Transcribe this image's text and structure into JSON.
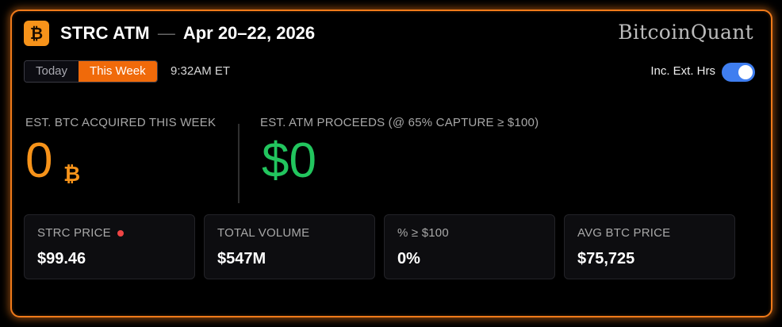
{
  "header": {
    "logo_glyph": "₿",
    "title": "STRC ATM",
    "separator": "—",
    "date_range": "Apr 20–22, 2026",
    "brand": "BitcoinQuant"
  },
  "controls": {
    "tabs": [
      {
        "label": "Today",
        "active": false
      },
      {
        "label": "This Week",
        "active": true
      }
    ],
    "time": "9:32AM ET",
    "ext_hours_label": "Inc. Ext. Hrs",
    "ext_hours_enabled": true
  },
  "summary": {
    "btc_label": "EST. BTC ACQUIRED THIS WEEK",
    "btc_value": "0",
    "btc_unit": "₿",
    "proceeds_label": "EST. ATM PROCEEDS (@ 65% CAPTURE ≥ $100)",
    "proceeds_value": "$0"
  },
  "stats": [
    {
      "label": "STRC PRICE",
      "value": "$99.46",
      "live": true
    },
    {
      "label": "TOTAL VOLUME",
      "value": "$547M",
      "live": false
    },
    {
      "label": "% ≥ $100",
      "value": "0%",
      "live": false
    },
    {
      "label": "AVG BTC PRICE",
      "value": "$75,725",
      "live": false
    }
  ],
  "colors": {
    "accent": "#f07a1a",
    "btc_orange": "#f7931a",
    "positive_green": "#22c55e",
    "toggle_blue": "#3f7ef0",
    "live_red": "#ef4444"
  }
}
